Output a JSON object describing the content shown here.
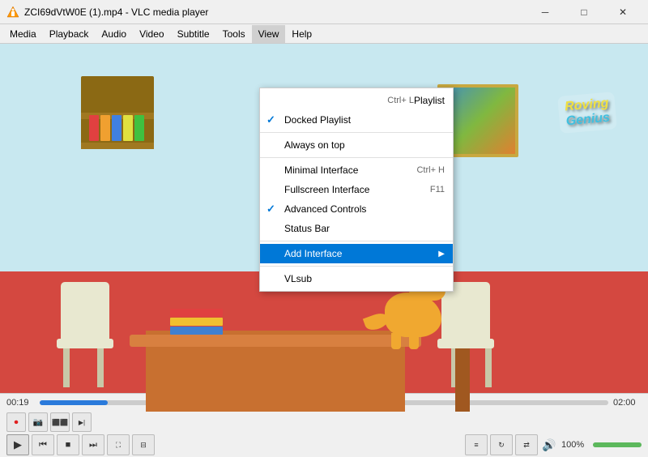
{
  "titlebar": {
    "title": "ZCI69dVtW0E (1).mp4 - VLC media player",
    "min_label": "─",
    "max_label": "□",
    "close_label": "✕"
  },
  "menubar": {
    "items": [
      {
        "id": "media",
        "label": "Media"
      },
      {
        "id": "playback",
        "label": "Playback"
      },
      {
        "id": "audio",
        "label": "Audio"
      },
      {
        "id": "video",
        "label": "Video"
      },
      {
        "id": "subtitle",
        "label": "Subtitle"
      },
      {
        "id": "tools",
        "label": "Tools"
      },
      {
        "id": "view",
        "label": "View"
      },
      {
        "id": "help",
        "label": "Help"
      }
    ],
    "active": "view"
  },
  "view_menu": {
    "sections": [
      {
        "items": [
          {
            "id": "playlist",
            "label": "Playlist",
            "shortcut": "Ctrl+ L",
            "checked": false
          },
          {
            "id": "docked-playlist",
            "label": "Docked Playlist",
            "shortcut": "",
            "checked": true
          }
        ]
      },
      {
        "items": [
          {
            "id": "always-on-top",
            "label": "Always on top",
            "shortcut": "",
            "checked": false
          }
        ]
      },
      {
        "items": [
          {
            "id": "minimal-interface",
            "label": "Minimal Interface",
            "shortcut": "Ctrl+ H",
            "checked": false
          },
          {
            "id": "fullscreen-interface",
            "label": "Fullscreen Interface",
            "shortcut": "F11",
            "checked": false
          },
          {
            "id": "advanced-controls",
            "label": "Advanced Controls",
            "shortcut": "",
            "checked": true
          },
          {
            "id": "status-bar",
            "label": "Status Bar",
            "shortcut": "",
            "checked": false
          }
        ]
      },
      {
        "items": [
          {
            "id": "add-interface",
            "label": "Add Interface",
            "shortcut": "",
            "checked": false,
            "has_arrow": true
          }
        ]
      },
      {
        "items": [
          {
            "id": "vlsub",
            "label": "VLsub",
            "shortcut": "",
            "checked": false
          }
        ]
      }
    ]
  },
  "playback": {
    "current_time": "00:19",
    "total_time": "02:00",
    "progress_percent": 12
  },
  "controls": {
    "row1_buttons": [
      {
        "id": "record",
        "icon": "⏺",
        "label": "Record"
      },
      {
        "id": "snapshot",
        "icon": "📷",
        "label": "Snapshot"
      },
      {
        "id": "loop-ab",
        "icon": "⊞",
        "label": "Loop A-B"
      },
      {
        "id": "frame-advance",
        "icon": "⏭",
        "label": "Frame Advance"
      }
    ],
    "row2_left": [
      {
        "id": "play",
        "icon": "▶",
        "label": "Play"
      },
      {
        "id": "prev",
        "icon": "⏮",
        "label": "Previous"
      },
      {
        "id": "stop",
        "icon": "■",
        "label": "Stop"
      },
      {
        "id": "next",
        "icon": "⏭",
        "label": "Next"
      },
      {
        "id": "fullscreen",
        "icon": "⛶",
        "label": "Fullscreen"
      },
      {
        "id": "extended",
        "icon": "⊟",
        "label": "Extended"
      },
      {
        "id": "playlist2",
        "icon": "≡",
        "label": "Playlist"
      },
      {
        "id": "loop",
        "icon": "↻",
        "label": "Loop"
      },
      {
        "id": "random",
        "icon": "⇄",
        "label": "Random"
      }
    ],
    "volume_icon": "🔊",
    "volume_label": "100%",
    "volume_percent": 100
  },
  "logo": {
    "line1": "Roving",
    "line2": "Genius"
  }
}
